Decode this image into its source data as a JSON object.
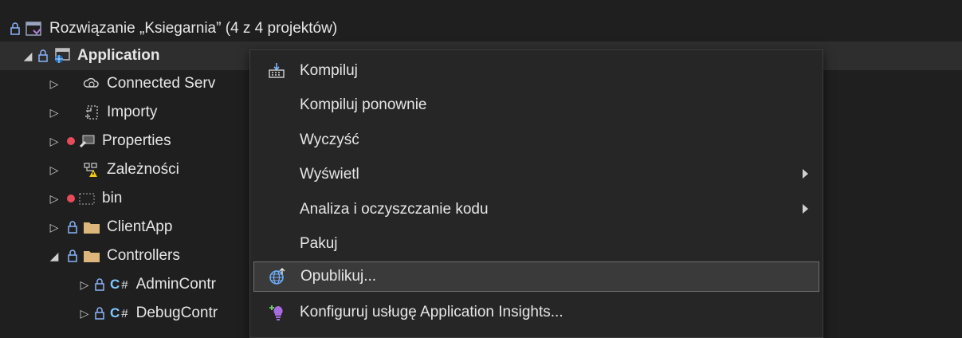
{
  "tree": {
    "solution_label": "Rozwiązanie „Ksiegarnia” (4 z 4 projektów)",
    "project_label": "Application",
    "items": [
      {
        "label": "Connected Serv"
      },
      {
        "label": "Importy"
      },
      {
        "label": "Properties"
      },
      {
        "label": "Zależności"
      },
      {
        "label": "bin"
      },
      {
        "label": "ClientApp"
      },
      {
        "label": "Controllers"
      },
      {
        "label": "AdminContr",
        "prefix": "C#"
      },
      {
        "label": "DebugContr",
        "prefix": "C#"
      }
    ]
  },
  "context_menu": {
    "items": [
      {
        "label": "Kompiluj",
        "icon": "build-icon"
      },
      {
        "label": "Kompiluj ponownie"
      },
      {
        "label": "Wyczyść"
      },
      {
        "label": "Wyświetl",
        "submenu": true
      },
      {
        "label": "Analiza i oczyszczanie kodu",
        "submenu": true
      },
      {
        "label": "Pakuj"
      },
      {
        "label": "Opublikuj...",
        "icon": "publish-globe-icon",
        "highlighted": true
      },
      {
        "label": "Konfiguruj usługę Application Insights...",
        "icon": "app-insights-icon"
      }
    ]
  },
  "colors": {
    "background": "#1f1f1f",
    "menu_background": "#262626",
    "highlight": "#3a3a3a",
    "error_dot": "#e84b5a",
    "folder": "#dcb67a",
    "csharp": "#7ec8ff"
  }
}
